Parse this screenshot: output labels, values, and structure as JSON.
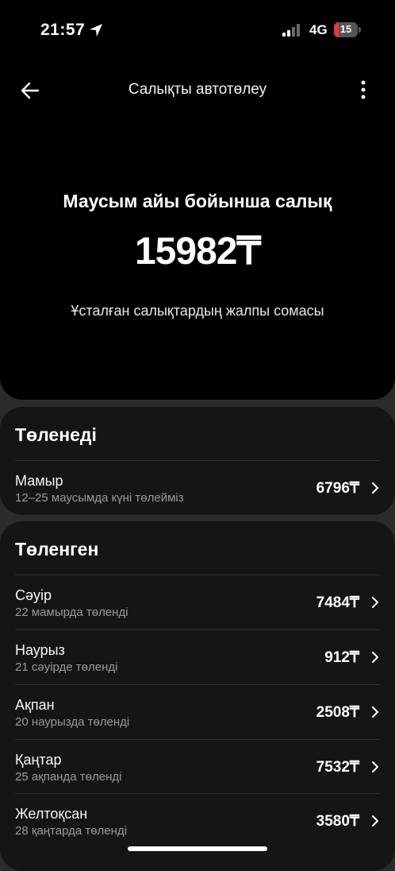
{
  "status_bar": {
    "time": "21:57",
    "network": "4G",
    "battery": "15",
    "battery_level": 0.15
  },
  "header": {
    "title": "Салықты автотөлеу"
  },
  "summary": {
    "title": "Маусым айы бойынша салық",
    "amount": "15982₸",
    "subtitle": "Ұсталған салықтардың жалпы сомасы"
  },
  "pending": {
    "title": "Төленеді",
    "items": [
      {
        "month": "Мамыр",
        "note": "12–25 маусымда күні төлейміз",
        "amount": "6796₸"
      }
    ]
  },
  "paid": {
    "title": "Төленген",
    "items": [
      {
        "month": "Сәуір",
        "note": "22 мамырда төленді",
        "amount": "7484₸"
      },
      {
        "month": "Наурыз",
        "note": "21 сәуірде төленді",
        "amount": "912₸"
      },
      {
        "month": "Ақпан",
        "note": "20 наурызда төленді",
        "amount": "2508₸"
      },
      {
        "month": "Қаңтар",
        "note": "25 ақпанда төленді",
        "amount": "7532₸"
      },
      {
        "month": "Желтоқсан",
        "note": "28 қаңтарда төленді",
        "amount": "3580₸"
      }
    ]
  },
  "icons": {
    "location": "location-arrow-icon",
    "signal": "cellular-signal-icon",
    "battery": "battery-icon",
    "back": "arrow-left-icon",
    "more": "more-vertical-icon",
    "chevron": "chevron-right-icon"
  }
}
